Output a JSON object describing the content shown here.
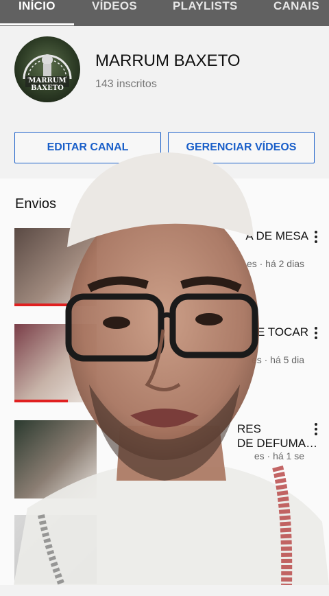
{
  "tabs": [
    {
      "label": "INÍCIO",
      "active": true
    },
    {
      "label": "VÍDEOS",
      "active": false
    },
    {
      "label": "PLAYLISTS",
      "active": false
    },
    {
      "label": "CANAIS",
      "active": false
    }
  ],
  "channel": {
    "name": "MARRUM BAXETO",
    "subscribers": "143 inscritos",
    "avatar_text": "MARRUM BAXETO"
  },
  "buttons": {
    "edit": "EDITAR CANAL",
    "manage": "GERENCIAR VÍDEOS"
  },
  "section": {
    "title": "Envios"
  },
  "videos": [
    {
      "title_fragment": "A DE MESA",
      "meta_fragment": "es · há 2 dias",
      "progress": 0.7
    },
    {
      "title_fragment": "E TOCAR",
      "meta_fragment": "es · há 5 dia",
      "progress": 0.65
    },
    {
      "title_fragment": "RES\nDE DEFUMA…",
      "meta_fragment": "es · há 1 se",
      "progress": 0
    },
    {
      "title_fragment": "",
      "meta_fragment": "",
      "progress": 0
    }
  ],
  "colors": {
    "tab_bar": "#616161",
    "accent_blue": "#1a5fc9",
    "progress_red": "#e02020"
  }
}
